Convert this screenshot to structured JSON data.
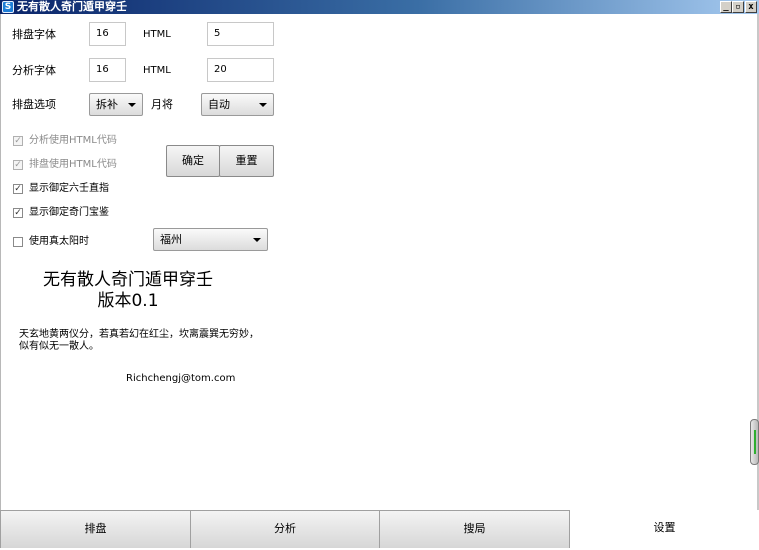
{
  "window": {
    "title": "无有散人奇门遁甲穿壬",
    "app_icon_glyph": "S",
    "minimize_glyph": "_",
    "maximize_glyph": "▫",
    "close_glyph": "x"
  },
  "settings": {
    "layout_font_label": "排盘字体",
    "layout_font_value": "16",
    "layout_html_label": "HTML",
    "layout_html_value": "5",
    "analysis_font_label": "分析字体",
    "analysis_font_value": "16",
    "analysis_html_label": "HTML",
    "analysis_html_value": "20",
    "layout_option_label": "排盘选项",
    "layout_option_value": "拆补",
    "month_general_label": "月将",
    "month_general_value": "自动"
  },
  "options": [
    {
      "label": "分析使用HTML代码",
      "checked": true,
      "disabled": true
    },
    {
      "label": "排盘使用HTML代码",
      "checked": true,
      "disabled": true
    },
    {
      "label": "显示御定六壬直指",
      "checked": true,
      "disabled": false
    },
    {
      "label": "显示御定奇门宝鉴",
      "checked": true,
      "disabled": false
    },
    {
      "label": "使用真太阳时",
      "checked": false,
      "disabled": false
    }
  ],
  "check_glyph": "✓",
  "city_value": "福州",
  "buttons": {
    "confirm": "确定",
    "reset": "重置"
  },
  "about": {
    "title": "无有散人奇门遁甲穿壬",
    "version": "版本0.1",
    "poem_line1": "天玄地黄两仪分，若真若幻在红尘，坎离震巽无穷妙，",
    "poem_line2": "似有似无一散人。",
    "email": "Richchengj@tom.com"
  },
  "tabs": [
    {
      "label": "排盘",
      "active": false
    },
    {
      "label": "分析",
      "active": false
    },
    {
      "label": "搜局",
      "active": false
    },
    {
      "label": "设置",
      "active": true
    }
  ]
}
